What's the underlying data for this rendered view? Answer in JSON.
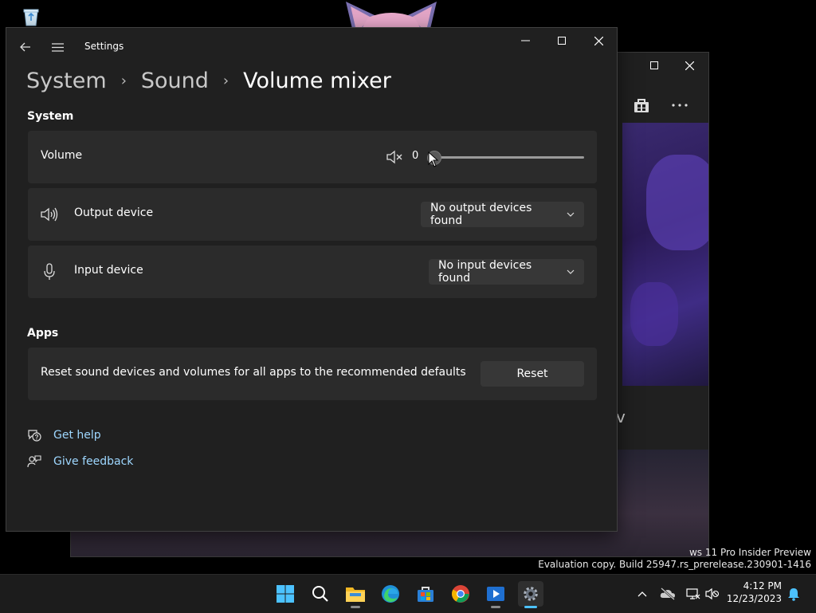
{
  "desktop": {
    "watermark_line1": "ws 11 Pro Insider Preview",
    "watermark_line2": "Evaluation copy. Build 25947.rs_prerelease.230901-1416"
  },
  "background_window": {
    "partial_text": "v"
  },
  "window": {
    "title": "Settings"
  },
  "breadcrumb": {
    "items": [
      "System",
      "Sound"
    ],
    "separator": "›",
    "current": "Volume mixer"
  },
  "system_section": {
    "title": "System",
    "volume": {
      "label": "Volume",
      "value": "0",
      "level": 0
    },
    "output_device": {
      "label": "Output device",
      "selected": "No output devices found"
    },
    "input_device": {
      "label": "Input device",
      "selected": "No input devices found"
    }
  },
  "apps_section": {
    "title": "Apps",
    "reset_text": "Reset sound devices and volumes for all apps to the recommended defaults",
    "reset_button": "Reset"
  },
  "links": {
    "get_help": "Get help",
    "give_feedback": "Give feedback"
  },
  "taskbar": {
    "apps": [
      "start",
      "search",
      "file-explorer",
      "edge",
      "microsoft-store",
      "chrome",
      "media-player",
      "settings"
    ],
    "time": "4:12 PM",
    "date": "12/23/2023"
  },
  "colors": {
    "accent": "#4cc2ff",
    "link": "#9ed7ff",
    "card": "#2b2b2b",
    "window": "#202020"
  }
}
